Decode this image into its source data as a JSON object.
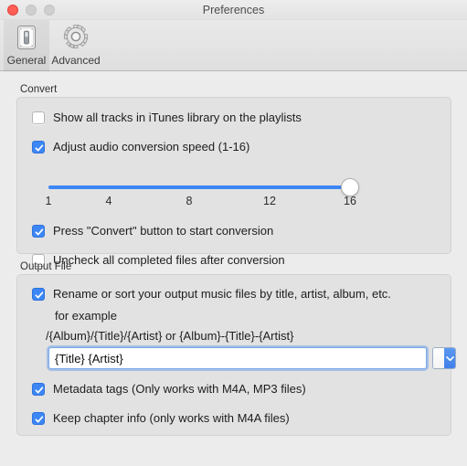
{
  "window": {
    "title": "Preferences",
    "traffic_lights": [
      {
        "name": "close",
        "color": "#ff5f57"
      },
      {
        "name": "minimize",
        "color": "#cfcfcf"
      },
      {
        "name": "zoom",
        "color": "#cfcfcf"
      }
    ]
  },
  "toolbar": {
    "items": [
      {
        "label": "General",
        "icon": "toggle-switch-icon",
        "selected": true
      },
      {
        "label": "Advanced",
        "icon": "gear-icon",
        "selected": false
      }
    ]
  },
  "convert": {
    "group_label": "Convert",
    "show_all_tracks": {
      "label": "Show all tracks in iTunes library on the playlists",
      "checked": false
    },
    "adjust_speed": {
      "label": "Adjust audio conversion speed (1-16)",
      "checked": true
    },
    "slider": {
      "min": 1,
      "max": 16,
      "value": 16,
      "ticks": [
        "1",
        "4",
        "8",
        "12",
        "16"
      ]
    },
    "press_convert": {
      "label": "Press \"Convert\" button to start conversion",
      "checked": true
    },
    "uncheck_completed": {
      "label": "Uncheck all completed files after conversion",
      "checked": false
    }
  },
  "output": {
    "group_label": "Output File",
    "rename_sort": {
      "label": "Rename or sort your output music files by title, artist, album, etc.",
      "checked": true
    },
    "example_heading": "for example",
    "example_pattern": "/{Album}/{Title}/{Artist} or {Album}-{Title}-{Artist}",
    "pattern_field": {
      "value": "{Title} {Artist}",
      "placeholder": ""
    },
    "metadata_tags": {
      "label": "Metadata tags (Only works with M4A, MP3 files)",
      "checked": true
    },
    "keep_chapter_info": {
      "label": "Keep chapter info (only works with  M4A files)",
      "checked": true
    }
  },
  "colors": {
    "accent": "#3d86f5",
    "window_bg": "#ececec",
    "group_bg": "#e2e2e2",
    "group_border": "#d2d2d2"
  }
}
